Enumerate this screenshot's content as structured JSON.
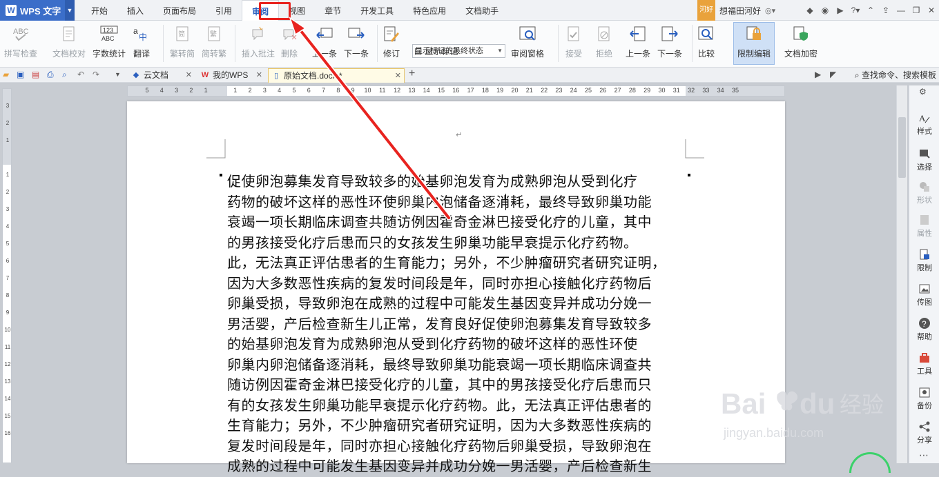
{
  "app": {
    "name": "WPS 文字"
  },
  "menu_tabs": [
    "开始",
    "插入",
    "页面布局",
    "引用",
    "审阅",
    "视图",
    "章节",
    "开发工具",
    "特色应用",
    "文档助手"
  ],
  "active_tab": "审阅",
  "user": {
    "badge": "河好",
    "name": "想福田河好"
  },
  "ribbon": {
    "spell_check": "拼写检查",
    "doc_proof": "文档校对",
    "word_count": "字数统计",
    "translate": "翻译",
    "trad_to_simp": "繁转简",
    "simp_to_trad": "简转繁",
    "insert_comment": "插入批注",
    "delete": "删除",
    "prev_comment": "上一条",
    "next_comment": "下一条",
    "track_changes": "修订",
    "display_mode": "显示标记的最终状态",
    "show_markup": "显示标记",
    "review_pane": "审阅窗格",
    "accept": "接受",
    "reject": "拒绝",
    "prev_change": "上一条",
    "next_change": "下一条",
    "compare": "比较",
    "restrict_edit": "限制编辑",
    "doc_encrypt": "文档加密"
  },
  "doc_tabs": [
    {
      "label": "云文档"
    },
    {
      "label": "我的WPS"
    },
    {
      "label": "原始文档.docx *"
    }
  ],
  "search_cmd": "查找命令、搜索模板",
  "ruler_ticks": [
    "5",
    "4",
    "3",
    "2",
    "1",
    "",
    "1",
    "2",
    "3",
    "4",
    "5",
    "6",
    "7",
    "8",
    "9",
    "10",
    "11",
    "12",
    "13",
    "14",
    "15",
    "16",
    "17",
    "18",
    "19",
    "20",
    "21",
    "22",
    "23",
    "24",
    "25",
    "26",
    "27",
    "28",
    "29",
    "30",
    "31",
    "32",
    "33",
    "34",
    "35"
  ],
  "vruler_ticks": [
    "3",
    "2",
    "1",
    "",
    "1",
    "2",
    "3",
    "4",
    "5",
    "6",
    "7",
    "8",
    "9",
    "10",
    "11",
    "12",
    "13",
    "14",
    "15",
    "16"
  ],
  "document": {
    "paragraph_mark": "↵",
    "lines": [
      "促使卵泡募集发育导致较多的始基卵泡发育为成熟卵泡从受到化疗",
      "药物的破坏这样的恶性环使卵巢内泡储备逐消耗，最终导致卵巢功能",
      "衰竭一项长期临床调查共随访例因霍奇金淋巴接受化疗的儿童，其中",
      "的男孩接受化疗后患而只的女孩发生卵巢功能早衰提示化疗药物。",
      "此，无法真正评估患者的生育能力；另外，不少肿瘤研究者研究证明，",
      "因为大多数恶性疾病的复发时间段是年，同时亦担心接触化疗药物后",
      "卵巢受损，导致卵泡在成熟的过程中可能发生基因变异并成功分娩一",
      "男活婴，产后检查新生儿正常，发育良好促使卵泡募集发育导致较多",
      "的始基卵泡发育为成熟卵泡从受到化疗药物的破坏这样的恶性环使",
      "卵巢内卵泡储备逐消耗，最终导致卵巢功能衰竭一项长期临床调查共",
      "随访例因霍奇金淋巴接受化疗的儿童，其中的男孩接受化疗后患而只",
      "有的女孩发生卵巢功能早衰提示化疗药物。此，无法真正评估患者的",
      "生育能力；另外，不少肿瘤研究者研究证明，因为大多数恶性疾病的",
      "复发时间段是年，同时亦担心接触化疗药物后卵巢受损，导致卵泡在",
      "成熟的过程中可能发生基因变异并成功分娩一男活婴，产后检查新生"
    ]
  },
  "sidebar": [
    {
      "label": "样式"
    },
    {
      "label": "选择"
    },
    {
      "label": "形状"
    },
    {
      "label": "属性"
    },
    {
      "label": "限制"
    },
    {
      "label": "传图"
    },
    {
      "label": "帮助"
    },
    {
      "label": "工具"
    },
    {
      "label": "备份"
    },
    {
      "label": "分享"
    }
  ],
  "watermark": {
    "brand": "Bai du经验",
    "url": "jingyan.baidu.com"
  },
  "colors": {
    "accent": "#2a5fbf",
    "highlight": "#e8231f"
  }
}
